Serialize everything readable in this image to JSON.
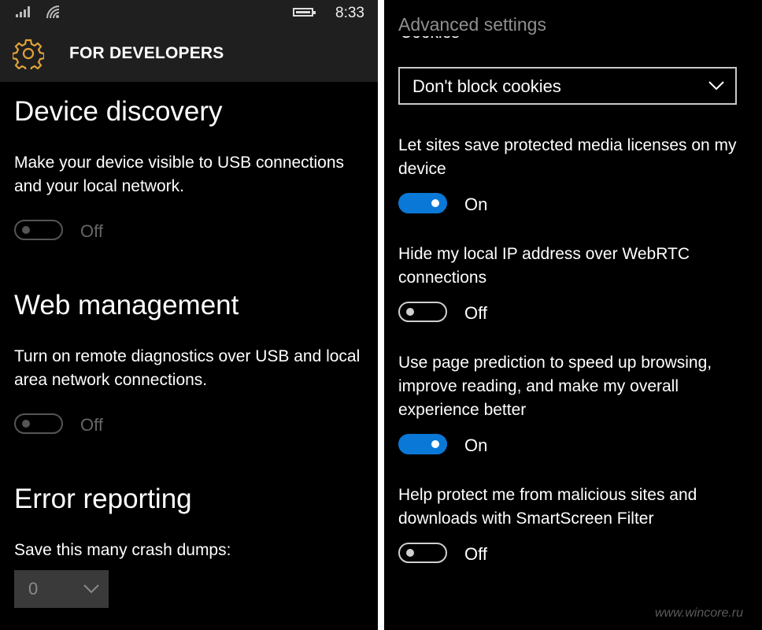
{
  "status_bar": {
    "time": "8:33"
  },
  "left": {
    "title": "FOR DEVELOPERS",
    "device_discovery": {
      "heading": "Device discovery",
      "description": "Make your device visible to USB connections and your local network.",
      "toggle_state": "Off"
    },
    "web_management": {
      "heading": "Web management",
      "description": "Turn on remote diagnostics over USB and local area network connections.",
      "toggle_state": "Off"
    },
    "error_reporting": {
      "heading": "Error reporting",
      "label": "Save this many crash dumps:",
      "value": "0"
    }
  },
  "right": {
    "title": "Advanced settings",
    "cookies_label": "Cookies",
    "cookies_value": "Don't block cookies",
    "settings": [
      {
        "text": "Let sites save protected media licenses on my device",
        "state": "On"
      },
      {
        "text": "Hide my local IP address over WebRTC connections",
        "state": "Off"
      },
      {
        "text": "Use page prediction to speed up browsing, improve reading, and make my overall experience better",
        "state": "On"
      },
      {
        "text": "Help protect me from malicious sites and downloads with SmartScreen Filter",
        "state": "Off"
      }
    ]
  },
  "watermark": "www.wincore.ru",
  "colors": {
    "accent": "#0a78d7",
    "gear": "#e0a23a",
    "bar": "#1f1f1f"
  }
}
